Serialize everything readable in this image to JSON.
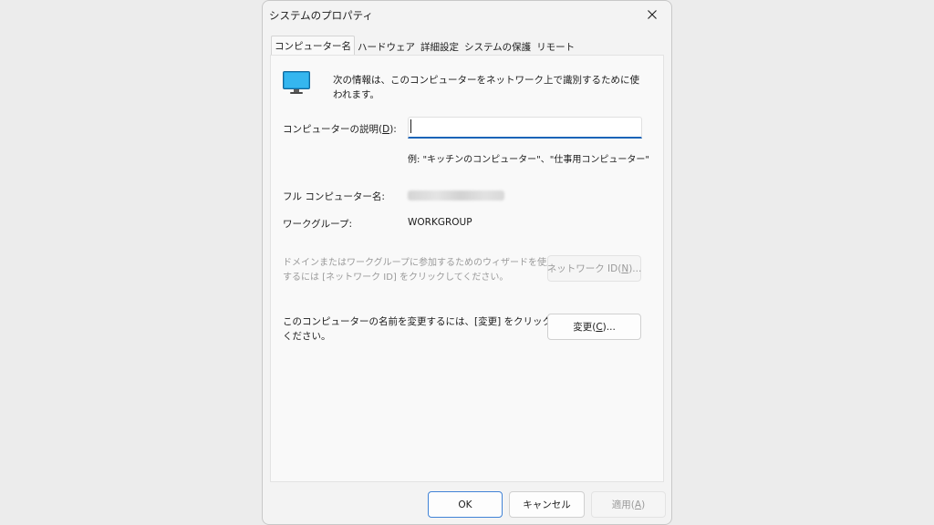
{
  "window": {
    "title": "システムのプロパティ",
    "close_icon": "close-icon"
  },
  "tabs": [
    {
      "label": "コンピューター名",
      "active": true
    },
    {
      "label": "ハードウェア",
      "active": false
    },
    {
      "label": "詳細設定",
      "active": false
    },
    {
      "label": "システムの保護",
      "active": false
    },
    {
      "label": "リモート",
      "active": false
    }
  ],
  "panel": {
    "icon": "monitor-icon",
    "info_text": "次の情報は、このコンピューターをネットワーク上で識別するために使われます。",
    "description_label_pre": "コンピューターの説明(",
    "description_label_key": "D",
    "description_label_post": "):",
    "description_value": "",
    "example_text": "例: \"キッチンのコンピューター\"、\"仕事用コンピューター\"",
    "full_name_label": "フル コンピューター名:",
    "workgroup_label": "ワークグループ:",
    "workgroup_value": "WORKGROUP",
    "wizard_text_line1": "ドメインまたはワークグループに参加するためのウィザードを使用",
    "wizard_text_line2": "するには [ネットワーク ID] をクリックしてください。",
    "network_id_button_pre": "ネットワーク ID(",
    "network_id_button_key": "N",
    "network_id_button_post": ")...",
    "rename_text_line1": "このコンピューターの名前を変更するには、[変更] をクリックして",
    "rename_text_line2": "ください。",
    "change_button_pre": "変更(",
    "change_button_key": "C",
    "change_button_post": ")..."
  },
  "footer": {
    "ok_label": "OK",
    "cancel_label": "キャンセル",
    "apply_label_pre": "適用(",
    "apply_label_key": "A",
    "apply_label_post": ")"
  },
  "colors": {
    "accent": "#1a64b8",
    "monitor_screen": "#1f9bd8",
    "disabled_text": "#9a9a9a"
  }
}
